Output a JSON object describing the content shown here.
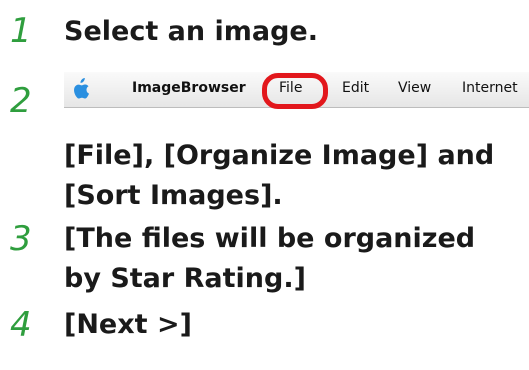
{
  "steps": [
    {
      "number": "1",
      "lines": [
        "Select an image."
      ]
    },
    {
      "number": "2",
      "lines": [
        "[File], [Organize Image] and",
        "[Sort Images]."
      ]
    },
    {
      "number": "3",
      "lines": [
        "[The files will be organized",
        "by Star Rating.]"
      ]
    },
    {
      "number": "4",
      "lines": [
        "[Next >]"
      ]
    }
  ],
  "menubar": {
    "apple_icon": "apple-logo-icon",
    "app_name": "ImageBrowser",
    "items": [
      "File",
      "Edit",
      "View",
      "Internet"
    ],
    "highlighted_item": "File",
    "highlight_color": "#e2171c"
  },
  "accent_color": "#2f9e3e"
}
